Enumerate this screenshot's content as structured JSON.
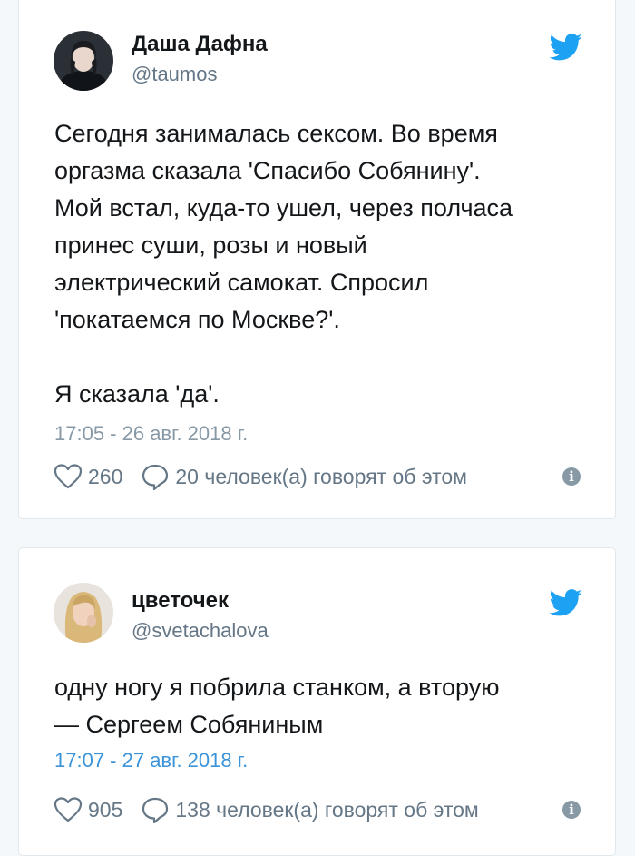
{
  "colors": {
    "background": "#f5f8fa",
    "card": "#ffffff",
    "twitter_blue": "#1da1f2",
    "muted": "#657786",
    "date_link": "#3b94d9"
  },
  "tweets": [
    {
      "display_name": "Даша Дафна",
      "handle": "@taumos",
      "text": "Сегодня занималась сексом. Во время\nоргазма сказала 'Спасибо Собянину'.\nМой встал, куда-то ушел, через полчаса\nпринес суши, розы и новый\nэлектрический самокат. Спросил\n'покатаемся по Москве?'.\n\nЯ сказала 'да'.",
      "date": "17:05 - 26 авг. 2018 г.",
      "likes": "260",
      "replies": "20 человек(а) говорят об этом",
      "icons": [
        "avatar",
        "twitter-bird-icon",
        "heart-icon",
        "speech-bubble-icon",
        "info-icon"
      ]
    },
    {
      "display_name": "цветочек",
      "handle": "@svetachalova",
      "text": "одну ногу я побрила станком, а вторую\n— Сергеем Собяниным",
      "date": "17:07 - 27 авг. 2018 г.",
      "likes": "905",
      "replies": "138 человек(а) говорят об этом",
      "icons": [
        "avatar",
        "twitter-bird-icon",
        "heart-icon",
        "speech-bubble-icon",
        "info-icon"
      ]
    }
  ],
  "info_glyph": "i"
}
